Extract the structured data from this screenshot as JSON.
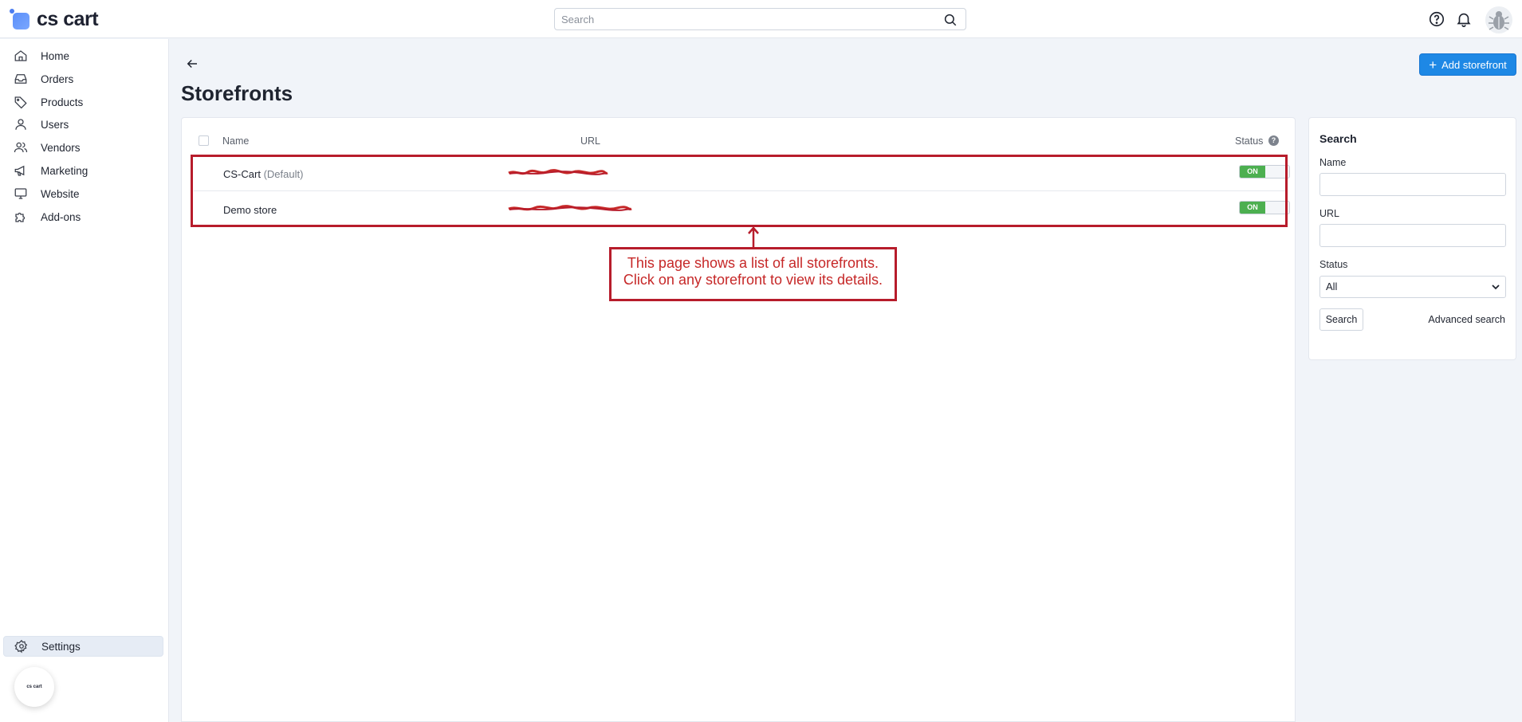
{
  "app": {
    "logo_text": "cs cart",
    "badge_text": "cs cart"
  },
  "topbar": {
    "search_placeholder": "Search"
  },
  "sidebar": {
    "items": [
      {
        "label": "Home",
        "icon": "home-icon"
      },
      {
        "label": "Orders",
        "icon": "inbox-icon"
      },
      {
        "label": "Products",
        "icon": "tag-icon"
      },
      {
        "label": "Users",
        "icon": "user-icon"
      },
      {
        "label": "Vendors",
        "icon": "users-icon"
      },
      {
        "label": "Marketing",
        "icon": "megaphone-icon"
      },
      {
        "label": "Website",
        "icon": "monitor-icon"
      },
      {
        "label": "Add-ons",
        "icon": "puzzle-icon"
      }
    ],
    "settings_label": "Settings"
  },
  "page": {
    "title": "Storefronts",
    "add_button_label": "Add storefront"
  },
  "table": {
    "headers": {
      "name": "Name",
      "url": "URL",
      "status": "Status"
    },
    "rows": [
      {
        "name": "CS-Cart",
        "note": "(Default)",
        "status": "ON"
      },
      {
        "name": "Demo store",
        "note": "",
        "status": "ON"
      }
    ]
  },
  "annotation": {
    "line1": "This page shows a list of all storefronts.",
    "line2": "Click on any storefront to view its details."
  },
  "search_panel": {
    "title": "Search",
    "name_label": "Name",
    "url_label": "URL",
    "status_label": "Status",
    "status_value": "All",
    "search_button": "Search",
    "advanced_link": "Advanced search"
  },
  "colors": {
    "accent": "#1e88e5",
    "toggle_on": "#4caf50",
    "annotation": "#b71c2b"
  }
}
